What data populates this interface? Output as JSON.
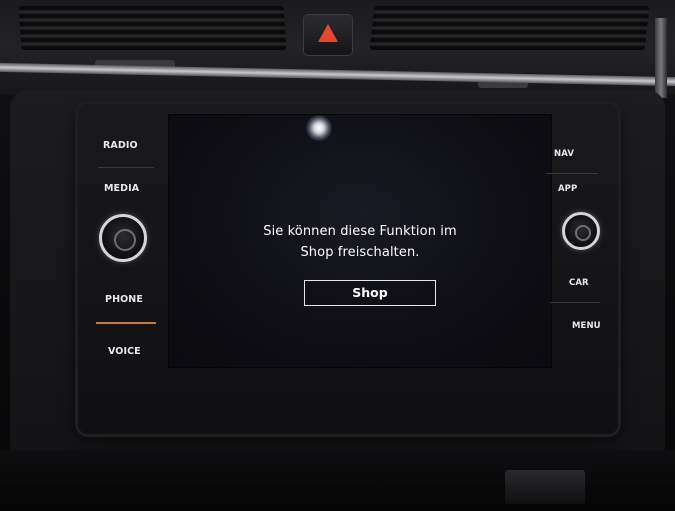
{
  "left_controls": {
    "radio": "RADIO",
    "media": "MEDIA",
    "phone": "PHONE",
    "voice": "VOICE"
  },
  "right_controls": {
    "nav": "NAV",
    "app": "APP",
    "car": "CAR",
    "menu": "MENU"
  },
  "screen": {
    "message_line1": "Sie können diese Funktion im",
    "message_line2": "Shop freischalten.",
    "shop_button_label": "Shop"
  },
  "colors": {
    "screen_bg": "#0e0e14",
    "text": "#ffffff",
    "hazard": "#e8482a",
    "accent": "#c97a3a"
  },
  "icons": {
    "hazard": "hazard-warning-icon",
    "left_knob": "volume-knob-icon",
    "right_knob": "tuning-knob-icon"
  }
}
